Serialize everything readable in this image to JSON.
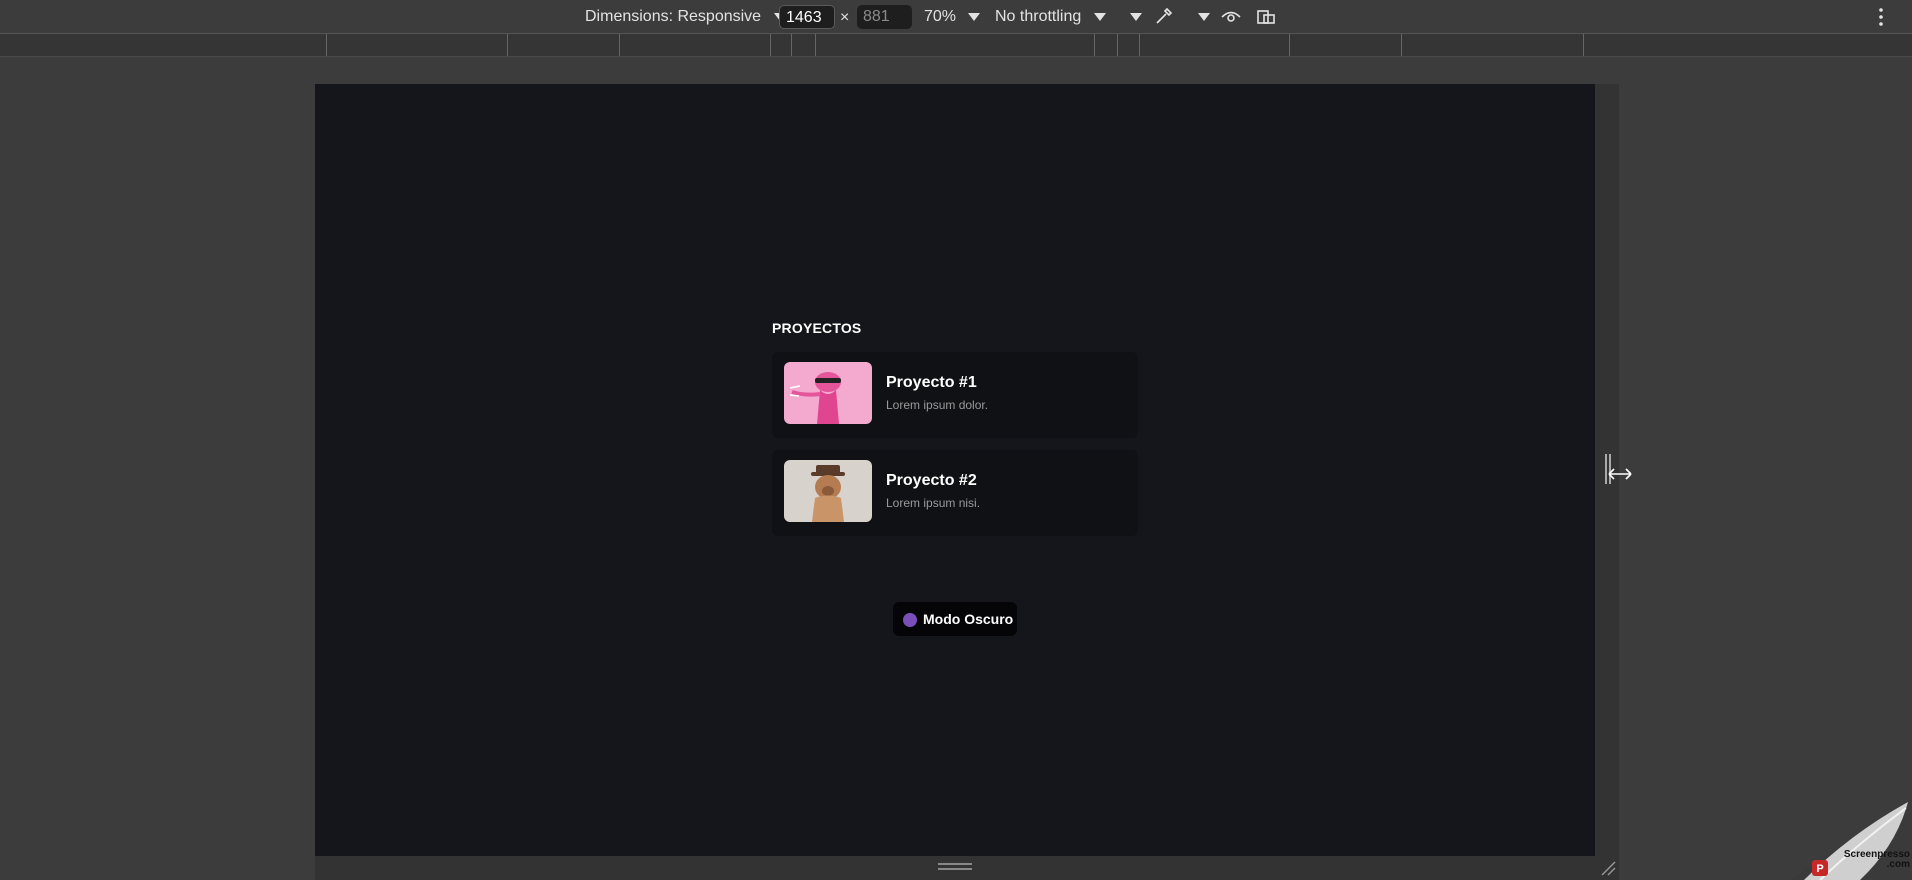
{
  "devtools": {
    "dimensions_label": "Dimensions: Responsive",
    "width_value": "1463",
    "times_sign": "×",
    "height_value": "881",
    "zoom": "70%",
    "throttling": "No throttling"
  },
  "page": {
    "section_title": "PROYECTOS",
    "projects": [
      {
        "title": "Proyecto #1",
        "description": "Lorem ipsum dolor."
      },
      {
        "title": "Proyecto #2",
        "description": "Lorem ipsum nisi."
      }
    ],
    "dark_mode_label": "Modo Oscuro"
  },
  "watermark": "Screenpresso .com",
  "colors": {
    "page_background": "#15161b",
    "card_background": "#101115",
    "devtools_background": "#3c3c3c"
  }
}
